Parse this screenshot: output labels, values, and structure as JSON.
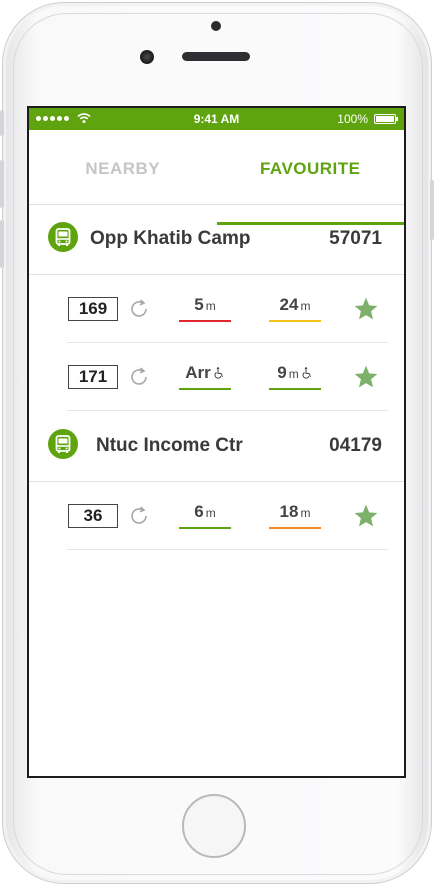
{
  "status_bar": {
    "time": "9:41 AM",
    "battery": "100%"
  },
  "tabs": [
    {
      "label": "NEARBY",
      "active": false
    },
    {
      "label": "FAVOURITE",
      "active": true
    }
  ],
  "colors": {
    "accent": "#5fa40f",
    "red": "#e0272b",
    "yellow": "#f0c419",
    "green": "#5fa40f",
    "orange": "#f08a24"
  },
  "stops": [
    {
      "name": "Opp Khatib Camp",
      "code": "57071",
      "services": [
        {
          "number": "169",
          "eta1": {
            "value": "5",
            "unit": "m",
            "load": "red",
            "wheelchair": false
          },
          "eta2": {
            "value": "24",
            "unit": "m",
            "load": "yellow",
            "wheelchair": false
          },
          "favourite": true
        },
        {
          "number": "171",
          "eta1": {
            "value": "Arr",
            "unit": "",
            "load": "green",
            "wheelchair": true
          },
          "eta2": {
            "value": "9",
            "unit": "m",
            "load": "green",
            "wheelchair": true
          },
          "favourite": true
        }
      ]
    },
    {
      "name": "Ntuc Income Ctr",
      "code": "04179",
      "services": [
        {
          "number": "36",
          "eta1": {
            "value": "6",
            "unit": "m",
            "load": "green",
            "wheelchair": false
          },
          "eta2": {
            "value": "18",
            "unit": "m",
            "load": "orange",
            "wheelchair": false
          },
          "favourite": true
        }
      ]
    }
  ],
  "icons": {
    "stop": "bus-icon",
    "refresh": "refresh-icon",
    "favourite": "star-icon",
    "accessible": "wheelchair-icon"
  }
}
